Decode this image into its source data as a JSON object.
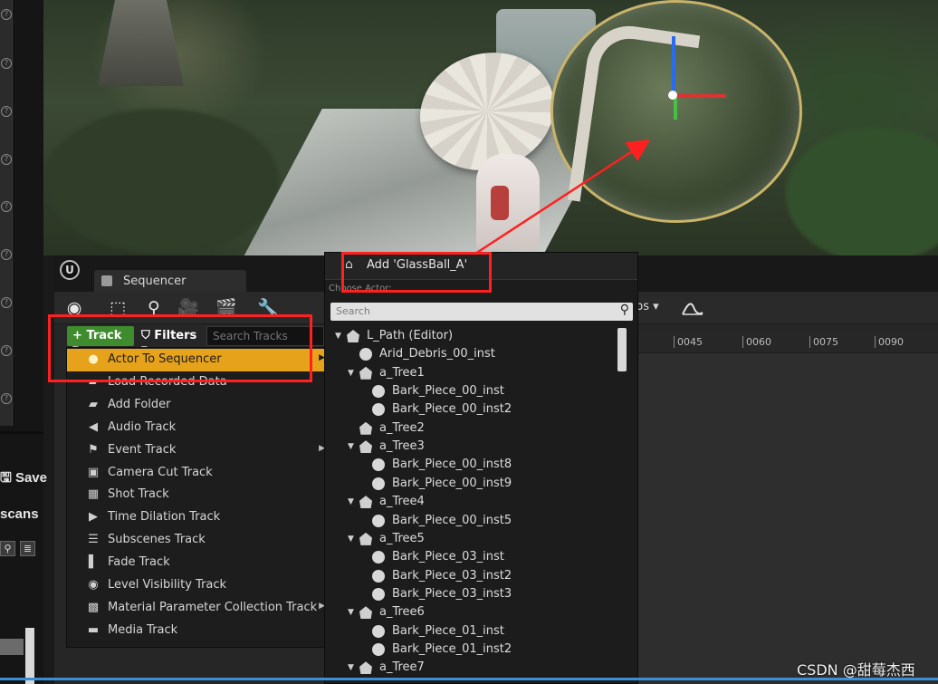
{
  "viewport": {
    "label": "3D viewport"
  },
  "left_panel": {
    "save_label": "Save",
    "scans_label": "scans"
  },
  "sequencer": {
    "tab_label": "Sequencer",
    "track_button_label": "Track",
    "filters_button_label": "Filters",
    "search_placeholder": "Search Tracks",
    "fps_label": "ps",
    "ruler_ticks": [
      "0045",
      "0060",
      "0075",
      "0090"
    ]
  },
  "track_menu": {
    "items": [
      {
        "label": "Actor To Sequencer",
        "icon": "actor-icon",
        "submenu": true,
        "highlighted": true
      },
      {
        "label": "Load Recorded Data",
        "icon": "folder-icon",
        "submenu": false
      },
      {
        "label": "Add Folder",
        "icon": "folder-icon",
        "submenu": false
      },
      {
        "label": "Audio Track",
        "icon": "speaker-icon",
        "submenu": false
      },
      {
        "label": "Event Track",
        "icon": "flag-icon",
        "submenu": true
      },
      {
        "label": "Camera Cut Track",
        "icon": "camera-icon",
        "submenu": false
      },
      {
        "label": "Shot Track",
        "icon": "film-icon",
        "submenu": false
      },
      {
        "label": "Time Dilation Track",
        "icon": "play-forward-icon",
        "submenu": false
      },
      {
        "label": "Subscenes Track",
        "icon": "layers-icon",
        "submenu": false
      },
      {
        "label": "Fade Track",
        "icon": "gradient-icon",
        "submenu": false
      },
      {
        "label": "Level Visibility Track",
        "icon": "eye-icon",
        "submenu": false
      },
      {
        "label": "Material Parameter Collection Track",
        "icon": "material-icon",
        "submenu": true
      },
      {
        "label": "Media Track",
        "icon": "media-icon",
        "submenu": false
      }
    ]
  },
  "actor_picker": {
    "header_label": "Add 'GlassBall_A'",
    "choose_actor_label": "Choose Actor:",
    "search_placeholder": "Search",
    "tree": [
      {
        "label": "L_Path (Editor)",
        "depth": 0,
        "kind": "world",
        "expanded": true
      },
      {
        "label": "Arid_Debris_00_inst",
        "depth": 1,
        "kind": "mesh"
      },
      {
        "label": "a_Tree1",
        "depth": 1,
        "kind": "folder",
        "expanded": true
      },
      {
        "label": "Bark_Piece_00_inst",
        "depth": 2,
        "kind": "mesh"
      },
      {
        "label": "Bark_Piece_00_inst2",
        "depth": 2,
        "kind": "mesh"
      },
      {
        "label": "a_Tree2",
        "depth": 1,
        "kind": "folder"
      },
      {
        "label": "a_Tree3",
        "depth": 1,
        "kind": "folder",
        "expanded": true
      },
      {
        "label": "Bark_Piece_00_inst8",
        "depth": 2,
        "kind": "mesh"
      },
      {
        "label": "Bark_Piece_00_inst9",
        "depth": 2,
        "kind": "mesh"
      },
      {
        "label": "a_Tree4",
        "depth": 1,
        "kind": "folder",
        "expanded": true
      },
      {
        "label": "Bark_Piece_00_inst5",
        "depth": 2,
        "kind": "mesh"
      },
      {
        "label": "a_Tree5",
        "depth": 1,
        "kind": "folder",
        "expanded": true
      },
      {
        "label": "Bark_Piece_03_inst",
        "depth": 2,
        "kind": "mesh"
      },
      {
        "label": "Bark_Piece_03_inst2",
        "depth": 2,
        "kind": "mesh"
      },
      {
        "label": "Bark_Piece_03_inst3",
        "depth": 2,
        "kind": "mesh"
      },
      {
        "label": "a_Tree6",
        "depth": 1,
        "kind": "folder",
        "expanded": true
      },
      {
        "label": "Bark_Piece_01_inst",
        "depth": 2,
        "kind": "mesh"
      },
      {
        "label": "Bark_Piece_01_inst2",
        "depth": 2,
        "kind": "mesh"
      },
      {
        "label": "a_Tree7",
        "depth": 1,
        "kind": "folder",
        "expanded": true
      }
    ]
  },
  "watermark": "CSDN @甜莓杰西",
  "colors": {
    "highlight": "#e6a21a",
    "track_button": "#3f8c2e",
    "annotation": "#ff2020",
    "background": "#1a1a1a"
  }
}
